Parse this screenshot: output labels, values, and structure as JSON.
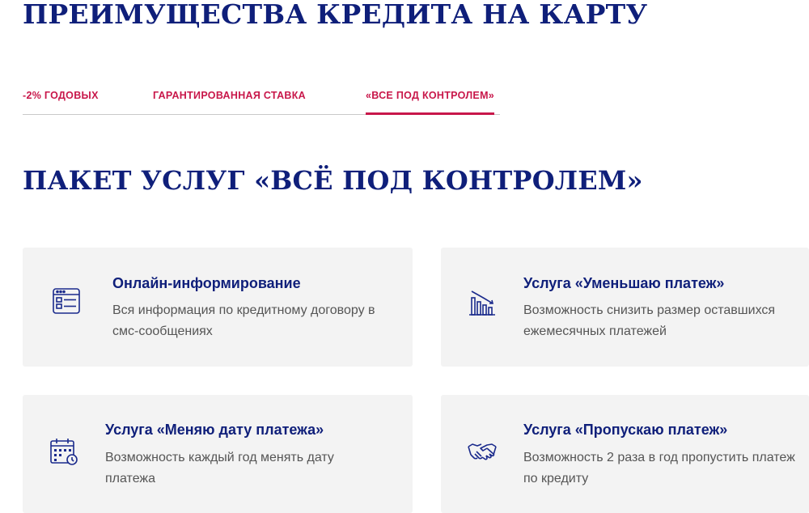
{
  "page": {
    "title": "ПРЕИМУЩЕСТВА КРЕДИТА НА КАРТУ"
  },
  "tabs": [
    {
      "label": "-2% ГОДОВЫХ",
      "active": false
    },
    {
      "label": "ГАРАНТИРОВАННАЯ СТАВКА",
      "active": false
    },
    {
      "label": "«ВСЕ ПОД КОНТРОЛЕМ»",
      "active": true
    }
  ],
  "section": {
    "title": "ПАКЕТ УСЛУГ «ВСЁ ПОД КОНТРОЛЕМ»"
  },
  "features": [
    {
      "icon": "online-info-icon",
      "title": "Онлайн-информирование",
      "description": "Вся информация по кредитному договору в смс-сообщениях"
    },
    {
      "icon": "chart-down-icon",
      "title": "Услуга «Уменьшаю платеж»",
      "description": "Возможность снизить размер оставшихся ежемесячных платежей"
    },
    {
      "icon": "calendar-icon",
      "title": "Услуга «Меняю дату платежа»",
      "description": "Возможность каждый год менять дату платежа"
    },
    {
      "icon": "handshake-icon",
      "title": "Услуга «Пропускаю платеж»",
      "description": "Возможность 2 раза в год пропустить платеж по кредиту"
    }
  ],
  "colors": {
    "heading": "#0f1f7a",
    "accent": "#c8174a",
    "card_bg": "#f3f3f3",
    "text": "#555555"
  }
}
